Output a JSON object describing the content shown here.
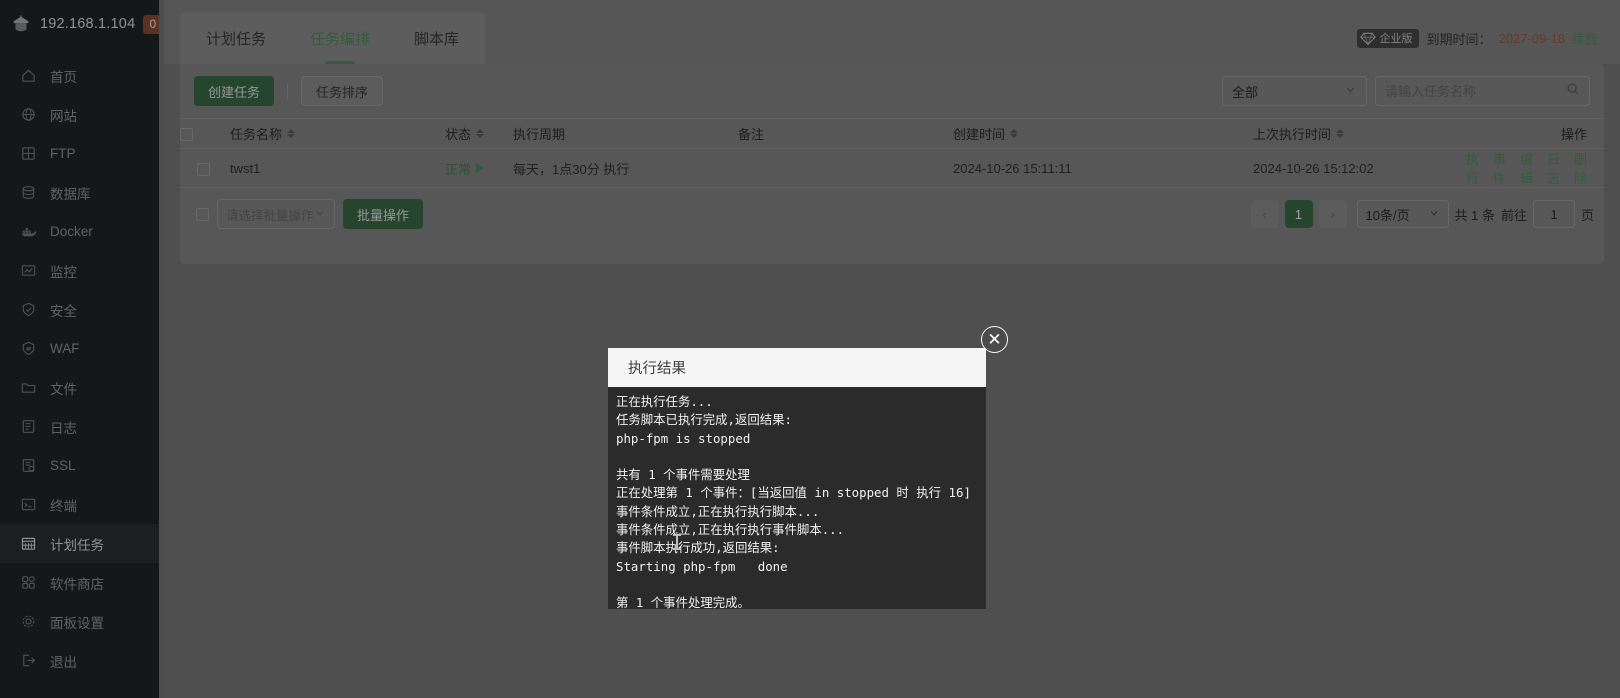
{
  "sidebar": {
    "ip": "192.168.1.104",
    "badge": "0",
    "items": [
      {
        "label": "首页",
        "icon": "home-icon"
      },
      {
        "label": "网站",
        "icon": "globe-icon"
      },
      {
        "label": "FTP",
        "icon": "ftp-icon"
      },
      {
        "label": "数据库",
        "icon": "database-icon"
      },
      {
        "label": "Docker",
        "icon": "docker-icon"
      },
      {
        "label": "监控",
        "icon": "monitor-icon"
      },
      {
        "label": "安全",
        "icon": "shield-icon"
      },
      {
        "label": "WAF",
        "icon": "waf-shield-icon"
      },
      {
        "label": "文件",
        "icon": "folder-icon"
      },
      {
        "label": "日志",
        "icon": "log-icon"
      },
      {
        "label": "SSL",
        "icon": "ssl-icon"
      },
      {
        "label": "终端",
        "icon": "terminal-icon"
      },
      {
        "label": "计划任务",
        "icon": "calendar-task-icon"
      },
      {
        "label": "软件商店",
        "icon": "appstore-icon"
      },
      {
        "label": "面板设置",
        "icon": "gear-icon"
      },
      {
        "label": "退出",
        "icon": "logout-icon"
      }
    ],
    "active_index": 12
  },
  "tabs": [
    {
      "label": "计划任务"
    },
    {
      "label": "任务编排"
    },
    {
      "label": "脚本库"
    }
  ],
  "active_tab_index": 1,
  "license": {
    "badge_text": "企业版",
    "expiry_label": "到期时间：",
    "expiry_date": "2027-09-18",
    "renew_label": "续费",
    "date_color": "#d8531f",
    "renew_color": "#2fa14e"
  },
  "toolbar": {
    "create_label": "创建任务",
    "sort_label": "任务排序",
    "filter_value": "全部",
    "search_placeholder": "请输入任务名称",
    "search_value": ""
  },
  "table": {
    "columns": [
      {
        "label": "任务名称",
        "sortable": true
      },
      {
        "label": "状态",
        "sortable": true
      },
      {
        "label": "执行周期",
        "sortable": false
      },
      {
        "label": "备注",
        "sortable": false
      },
      {
        "label": "创建时间",
        "sortable": true
      },
      {
        "label": "上次执行时间",
        "sortable": true
      },
      {
        "label": "操作",
        "sortable": false
      }
    ],
    "rows": [
      {
        "name": "twst1",
        "status": "正常",
        "cycle": "每天，1点30分 执行",
        "remark": "",
        "created": "2024-10-26 15:11:11",
        "last_run": "2024-10-26 15:12:02",
        "actions": [
          "执行",
          "事件",
          "编辑",
          "日志",
          "删除"
        ]
      }
    ]
  },
  "footer": {
    "batch_select_placeholder": "请选择批量操作",
    "batch_button": "批量操作",
    "prev_arrow": "‹",
    "next_arrow": "›",
    "current_page": "1",
    "page_size": "10条/页",
    "total_text": "共 1 条",
    "goto_label": "前往",
    "goto_value": "1",
    "page_unit": "页"
  },
  "modal": {
    "title": "执行结果",
    "close_icon": "✕",
    "lines": [
      "正在执行任务...",
      "任务脚本已执行完成,返回结果:",
      "php-fpm is stopped",
      "",
      "共有 1 个事件需要处理",
      "正在处理第 1 个事件：[当返回值 in stopped 时 执行 16]",
      "事件条件成立,正在执行执行脚本...",
      "事件条件成立,正在执行执行事件脚本...",
      "事件脚本执行成功,返回结果:",
      "Starting php-fpm   done",
      "",
      "第 1 个事件处理完成。",
      "——————————————————"
    ]
  }
}
